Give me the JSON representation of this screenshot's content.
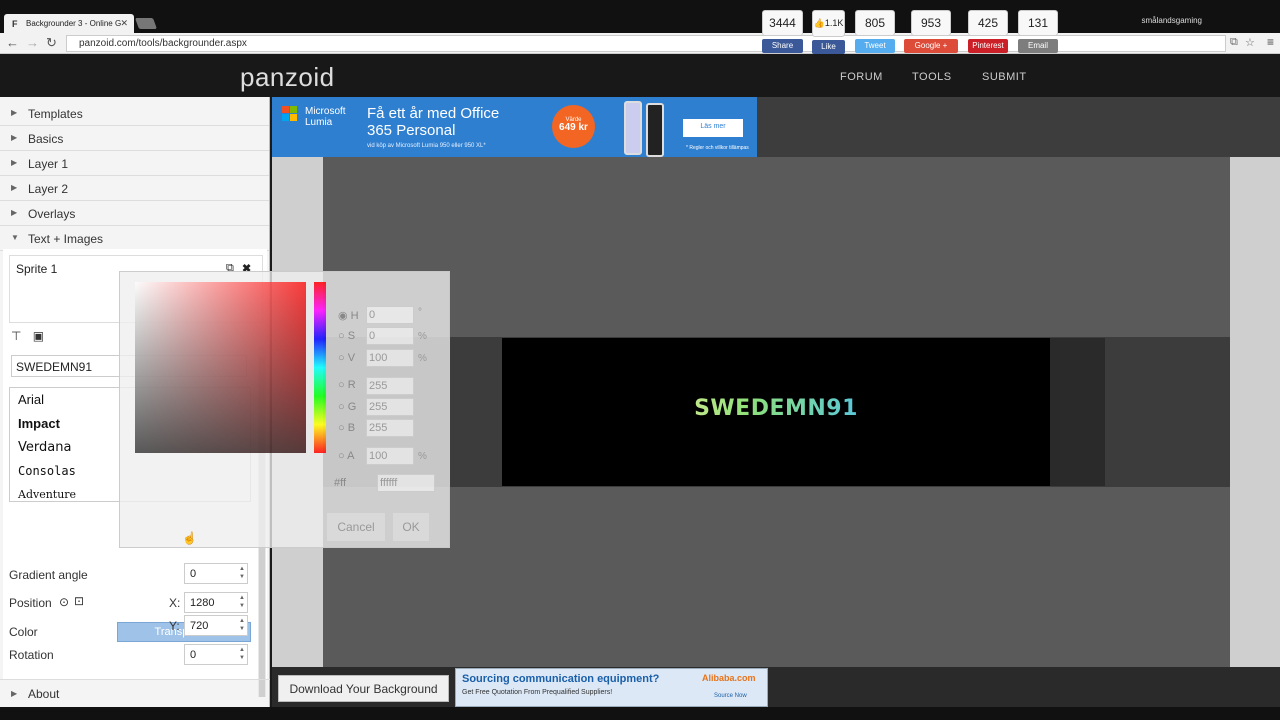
{
  "browser": {
    "tab_title": "Backgrounder 3 - Online G",
    "tab_favicon": "F",
    "profile": "smålandsgaming",
    "url": "panzoid.com/tools/backgrounder.aspx"
  },
  "site": {
    "logo": "panzoid",
    "nav": [
      "FORUM",
      "TOOLS",
      "SUBMIT"
    ]
  },
  "sidebar": {
    "sections": [
      "Templates",
      "Basics",
      "Layer 1",
      "Layer 2",
      "Overlays",
      "Text + Images"
    ],
    "about": "About"
  },
  "editor": {
    "sprite_name": "Sprite 1",
    "text_value": "SWEDEMN91",
    "fonts": [
      "Arial",
      "Impact",
      "Verdana",
      "Consolas",
      "Adventure"
    ],
    "color_label": "Color",
    "color_value": "Transparent",
    "gradient_label": "Gradient angle",
    "gradient_value": "0",
    "position_label": "Position",
    "x_label": "X:",
    "x_value": "1280",
    "y_label": "Y:",
    "y_value": "720",
    "rotation_label": "Rotation",
    "rotation_value": "0"
  },
  "picker": {
    "h_label": "H",
    "h_value": "0",
    "h_unit": "°",
    "s_label": "S",
    "s_value": "0",
    "s_unit": "%",
    "v_label": "V",
    "v_value": "100",
    "v_unit": "%",
    "r_label": "R",
    "r_value": "255",
    "g_label": "G",
    "g_value": "255",
    "b_label": "B",
    "b_value": "255",
    "a_label": "A",
    "a_value": "100",
    "a_unit": "%",
    "hex_prefix": "#ff",
    "hex_value": "ffffff",
    "cancel": "Cancel",
    "ok": "OK"
  },
  "ad_top": {
    "brand_line1": "Microsoft",
    "brand_line2": "Lumia",
    "headline": "Få ett år med Office 365 Personal",
    "sub": "vid köp av Microsoft Lumia 950 eller 950 XL*",
    "price_top": "Värde",
    "price": "649 kr",
    "button": "Läs mer",
    "small": "* Regler och villkor tillämpas"
  },
  "share": [
    {
      "count": "3444",
      "label": "Share",
      "color": "#3b5998"
    },
    {
      "count": "1.1K",
      "label": "Like",
      "color": "#3b5998"
    },
    {
      "count": "805",
      "label": "Tweet",
      "color": "#55acee"
    },
    {
      "count": "953",
      "label": "Google +",
      "color": "#dd4b39"
    },
    {
      "count": "425",
      "label": "Pinterest",
      "color": "#cb2027"
    },
    {
      "count": "131",
      "label": "Email",
      "color": "#7d7d7d"
    }
  ],
  "banner": {
    "text": "SWEDEMN91"
  },
  "bottom": {
    "download": "Download Your Background",
    "ad_title": "Sourcing communication equipment?",
    "ad_sub": "Get Free Quotation From Prequalified Suppliers!",
    "ad_brand": "Alibaba.com",
    "ad_link": "Source Now"
  }
}
